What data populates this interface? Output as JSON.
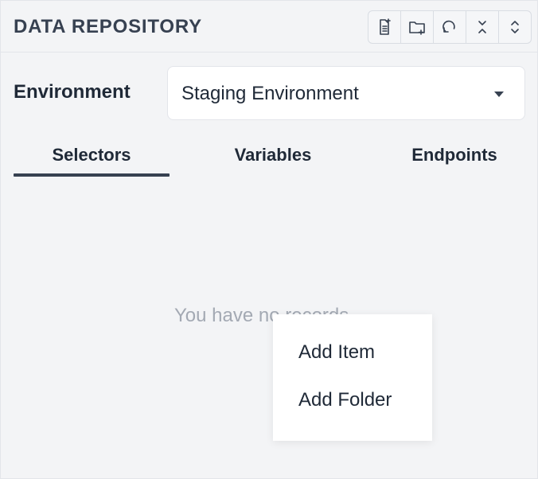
{
  "header": {
    "title": "DATA REPOSITORY",
    "toolbar": [
      {
        "icon": "add-item-icon"
      },
      {
        "icon": "add-folder-icon"
      },
      {
        "icon": "refresh-icon"
      },
      {
        "icon": "collapse-all-icon"
      },
      {
        "icon": "expand-all-icon"
      }
    ]
  },
  "environment": {
    "label": "Environment",
    "selected": "Staging Environment"
  },
  "tabs": [
    {
      "label": "Selectors",
      "active": true
    },
    {
      "label": "Variables",
      "active": false
    },
    {
      "label": "Endpoints",
      "active": false
    }
  ],
  "empty_state": "You have no records",
  "context_menu": {
    "items": [
      "Add Item",
      "Add Folder"
    ]
  },
  "colors": {
    "panel_bg": "#f3f4f6",
    "text": "#1f2937",
    "muted_text": "#a3a9b3",
    "active_tab_underline": "#374151"
  }
}
